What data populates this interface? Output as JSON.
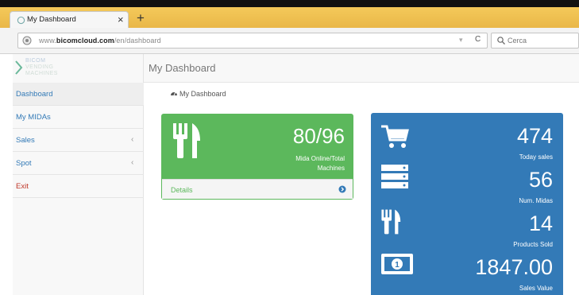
{
  "browser": {
    "tab_title": "My Dashboard",
    "tab_close": "×",
    "new_tab": "+",
    "url_domain": "www.bicomcloud.com",
    "url_path": "/en/dashboard",
    "url_prefix": "www.",
    "url_host": "bicomcloud.com",
    "reload": "C",
    "search_placeholder": "Cerca"
  },
  "logo": {
    "line1": "BICOM",
    "line2": "VENDING",
    "line3": "MACHINES"
  },
  "sidebar": {
    "items": [
      {
        "label": "Dashboard",
        "has_arrow": false
      },
      {
        "label": "My MIDAs",
        "has_arrow": false
      },
      {
        "label": "Sales",
        "has_arrow": true
      },
      {
        "label": "Spot",
        "has_arrow": true
      },
      {
        "label": "Exit",
        "has_arrow": false
      }
    ],
    "arrow": "‹"
  },
  "header": {
    "title": "My Dashboard"
  },
  "breadcrumb": {
    "label": "My Dashboard"
  },
  "machines_panel": {
    "value": "80/96",
    "caption_line1": "Mida Online/Total",
    "caption_line2": "Machines",
    "details_label": "Details",
    "color": "#5cb85c"
  },
  "stats_panel": {
    "color": "#337ab7",
    "stats": [
      {
        "icon": "cart-icon",
        "value": "474",
        "caption": "Today sales"
      },
      {
        "icon": "server-icon",
        "value": "56",
        "caption": "Num. Midas"
      },
      {
        "icon": "cutlery-icon",
        "value": "14",
        "caption": "Products Sold"
      },
      {
        "icon": "money-icon",
        "value": "1847.00",
        "caption": "Sales Value"
      }
    ]
  }
}
